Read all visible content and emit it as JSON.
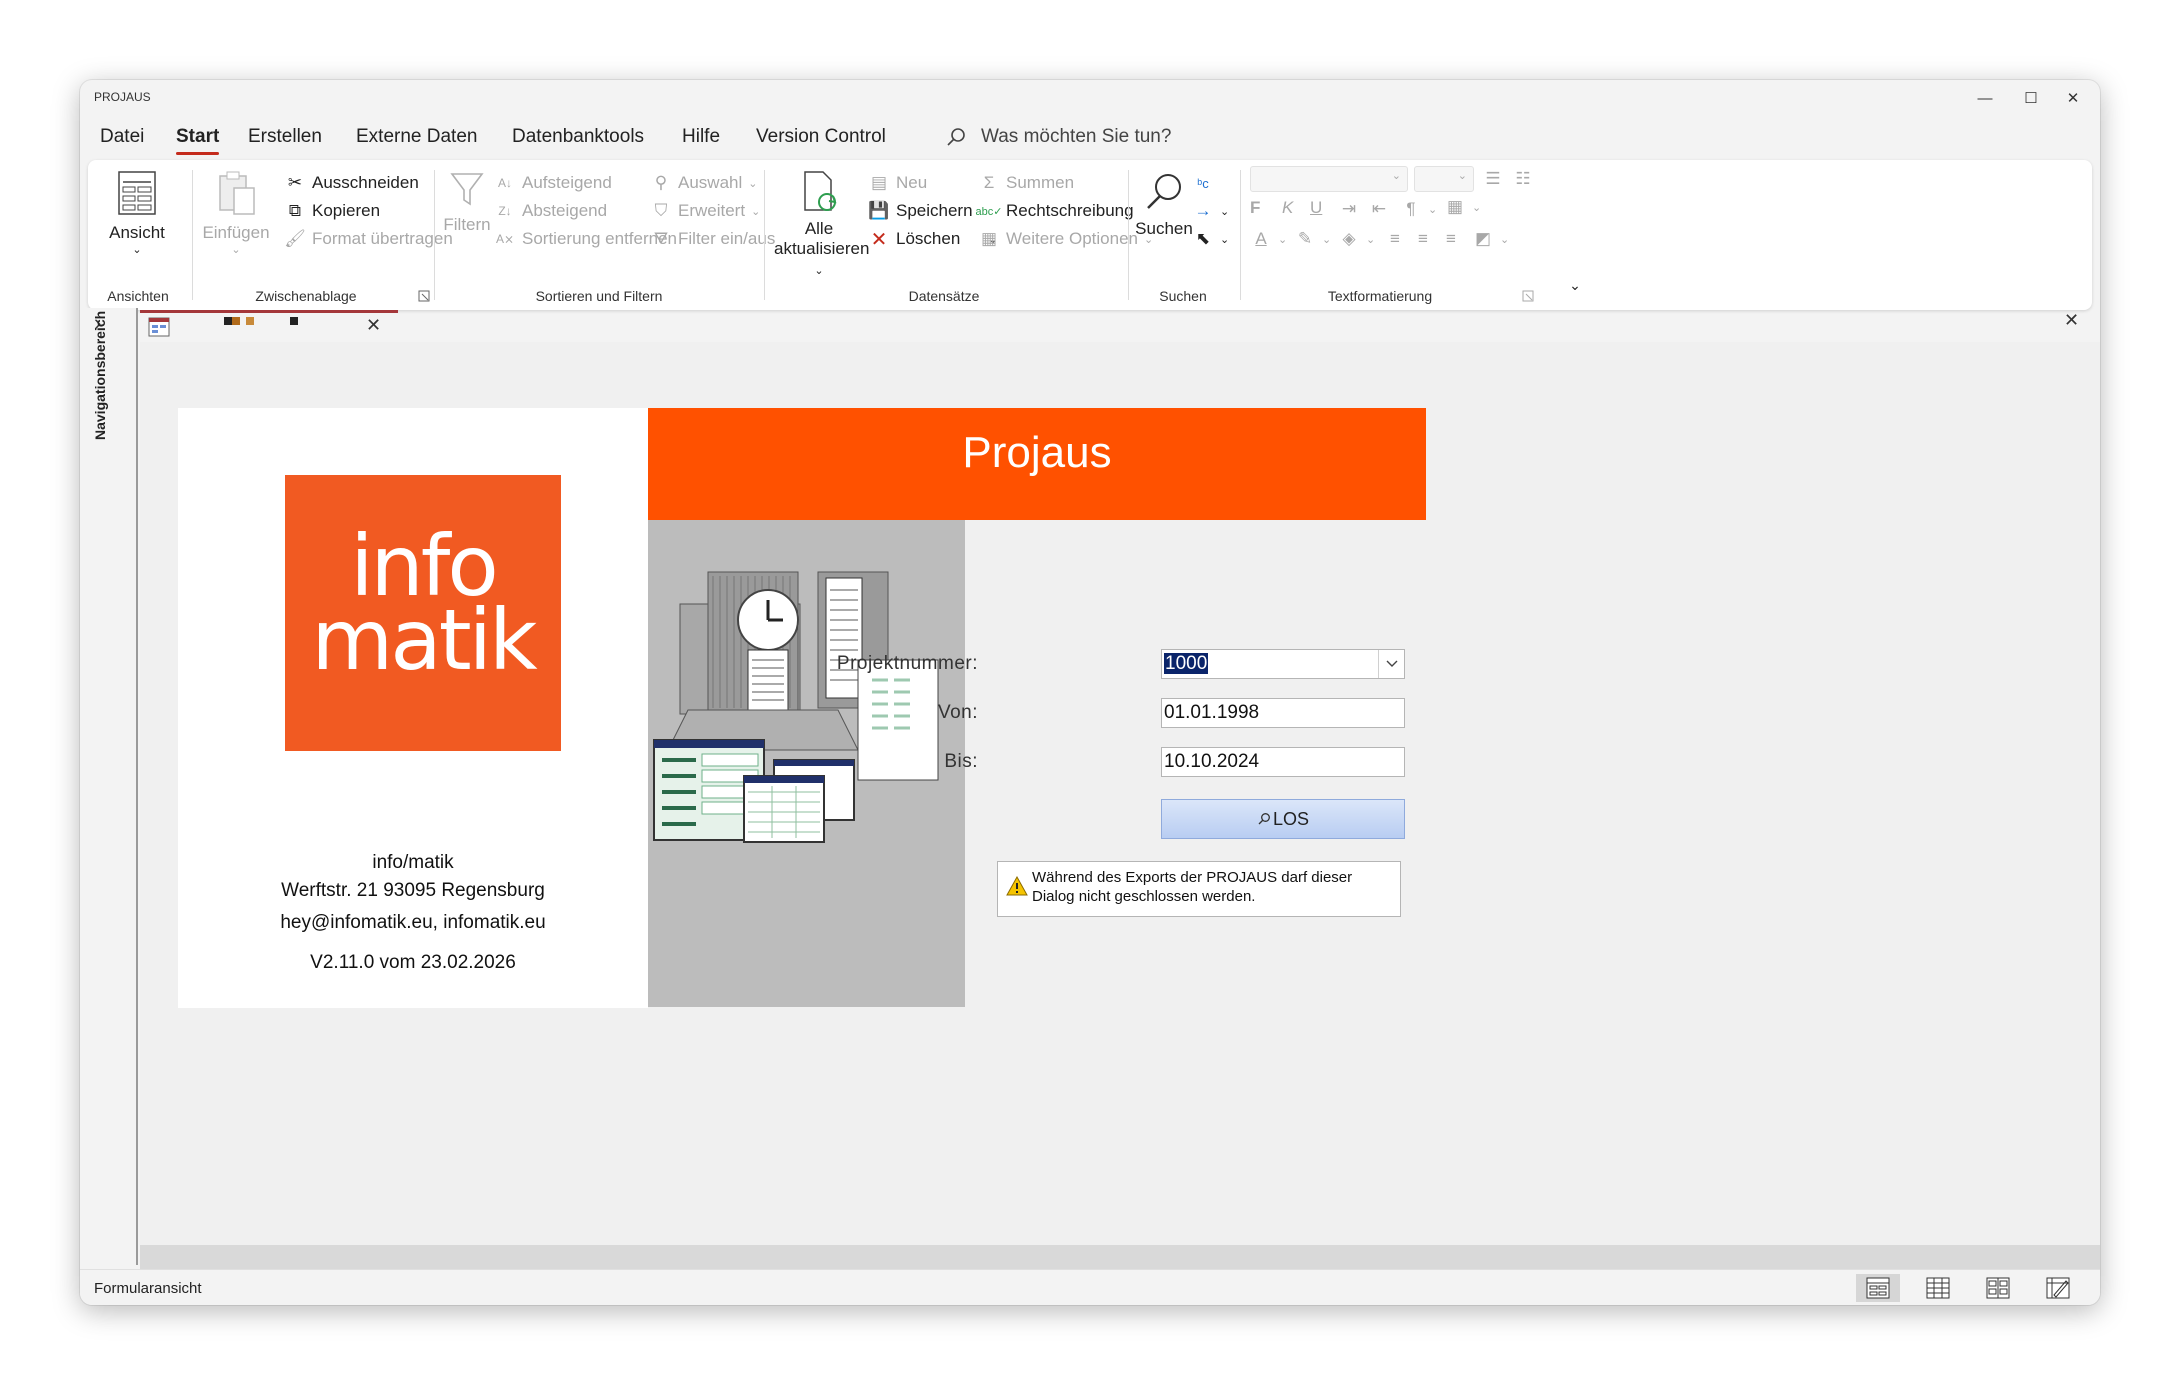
{
  "window": {
    "title": "PROJAUS",
    "minimize": "—",
    "maximize": "☐",
    "close": "✕"
  },
  "menu": {
    "items": [
      "Datei",
      "Start",
      "Erstellen",
      "Externe Daten",
      "Datenbanktools",
      "Hilfe",
      "Version Control"
    ],
    "active": "Start",
    "tellme": "Was möchten Sie tun?"
  },
  "ribbon": {
    "ansichten": {
      "label": "Ansichten",
      "ansicht": "Ansicht"
    },
    "zwischenablage": {
      "label": "Zwischenablage",
      "einfuegen": "Einfügen",
      "ausschneiden": "Ausschneiden",
      "kopieren": "Kopieren",
      "format": "Format übertragen"
    },
    "sortieren": {
      "label": "Sortieren und Filtern",
      "filtern": "Filtern",
      "aufsteigend": "Aufsteigend",
      "absteigend": "Absteigend",
      "sortierung_entfernen": "Sortierung entfernen",
      "auswahl": "Auswahl",
      "erweitert": "Erweitert",
      "filter_einaus": "Filter ein/aus"
    },
    "datensaetze": {
      "label": "Datensätze",
      "alle": "Alle",
      "aktualisieren": "aktualisieren",
      "neu": "Neu",
      "speichern": "Speichern",
      "loeschen": "Löschen",
      "summen": "Summen",
      "rechtschreibung": "Rechtschreibung",
      "weitere": "Weitere Optionen"
    },
    "suchen": {
      "label": "Suchen",
      "suchen": "Suchen"
    },
    "textformat": {
      "label": "Textformatierung",
      "bold": "F",
      "italic": "K",
      "underline": "U"
    }
  },
  "nav": {
    "label": "Navigationsbereich"
  },
  "form": {
    "title": "Projaus",
    "company": {
      "name": "info/matik",
      "address": "Werftstr. 21 93095 Regensburg",
      "contact": "hey@infomatik.eu, infomatik.eu",
      "version": "V2.11.0 vom 23.02.2026"
    },
    "logo": {
      "line1": "info",
      "line2": "matik"
    },
    "fields": {
      "projekt_label": "Projektnummer:",
      "projekt_value": "1000",
      "von_label": "Von:",
      "von_value": "01.01.1998",
      "bis_label": "Bis:",
      "bis_value": "10.10.2024"
    },
    "button": "LOS",
    "warning": [
      "Während des Exports der PROJAUS darf dieser",
      "Dialog nicht geschlossen werden."
    ]
  },
  "status": {
    "text": "Formularansicht"
  },
  "colors": {
    "accent": "#ff5100",
    "logo": "#f15a22",
    "tab_accent": "#a4373a"
  }
}
